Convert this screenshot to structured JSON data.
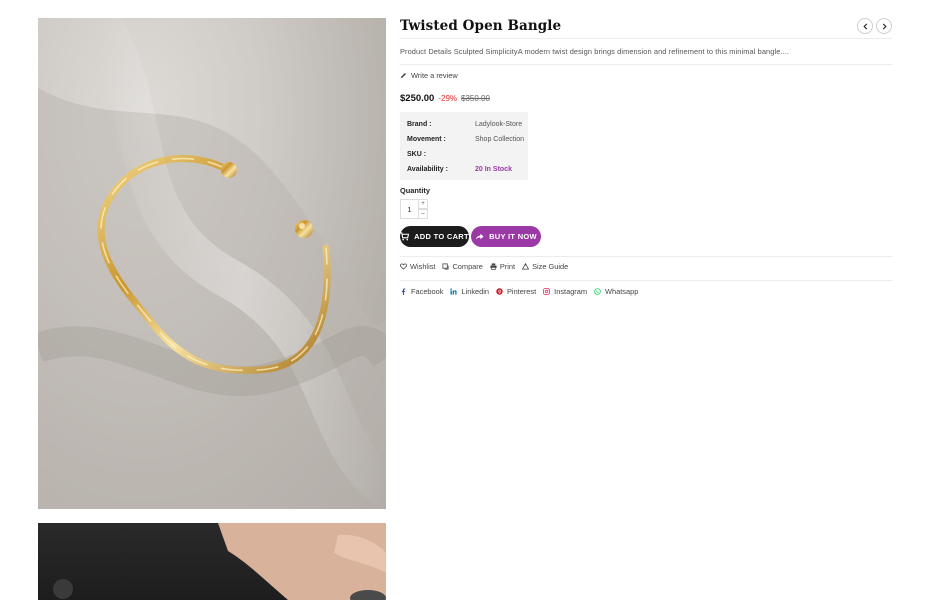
{
  "product": {
    "title": "Twisted Open Bangle",
    "description": "Product Details Sculpted SimplicityA modern twist design brings dimension and refinement to this minimal bangle....",
    "review_link": "Write a review",
    "price": "$250.00",
    "discount": "-29%",
    "compare_price": "$350.00",
    "specs": [
      {
        "label": "Brand :",
        "value": "Ladylook-Store"
      },
      {
        "label": "Movement :",
        "value": "Shop Collection"
      },
      {
        "label": "SKU :",
        "value": ""
      },
      {
        "label": "Availability :",
        "value": "20 In Stock"
      }
    ],
    "quantity_label": "Quantity",
    "quantity_value": "1",
    "qty_plus": "+",
    "qty_minus": "–",
    "add_to_cart": "ADD TO CART",
    "buy_it_now": "BUY IT NOW"
  },
  "actions": [
    {
      "label": "Wishlist",
      "icon": "heart-icon"
    },
    {
      "label": "Compare",
      "icon": "compare-icon"
    },
    {
      "label": "Print",
      "icon": "printer-icon"
    },
    {
      "label": "Size Guide",
      "icon": "size-guide-icon"
    }
  ],
  "social": [
    {
      "label": "Facebook",
      "icon": "facebook-icon",
      "color": "#3b5998"
    },
    {
      "label": "Linkedin",
      "icon": "linkedin-icon",
      "color": "#0e76a8"
    },
    {
      "label": "Pinterest",
      "icon": "pinterest-icon",
      "color": "#cb2027"
    },
    {
      "label": "Instagram",
      "icon": "instagram-icon",
      "color": "#e1306c"
    },
    {
      "label": "Whatsapp",
      "icon": "whatsapp-icon",
      "color": "#25d366"
    }
  ],
  "colors": {
    "accent": "#9b3aa6",
    "cart_button": "#1c1c1c",
    "discount": "#e22b2b"
  }
}
